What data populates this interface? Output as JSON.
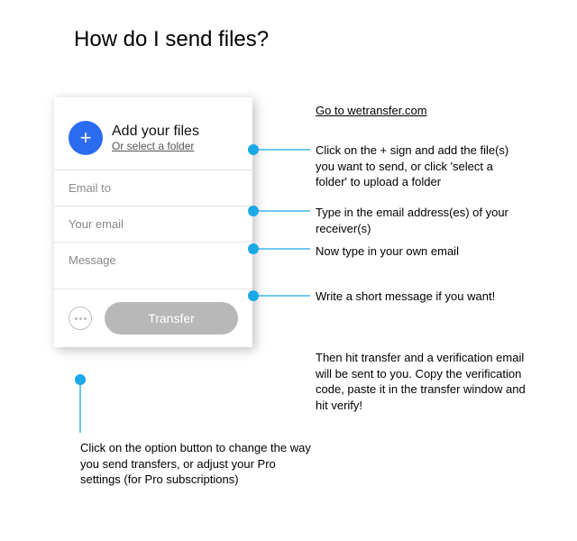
{
  "title": "How do I send files?",
  "panel": {
    "add_label": "Add your files",
    "select_folder_label": "Or select a folder",
    "email_to_placeholder": "Email to",
    "your_email_placeholder": "Your email",
    "message_placeholder": "Message",
    "transfer_label": "Transfer"
  },
  "annotations": {
    "goto": "Go to wetransfer.com",
    "add_files": "Click on the + sign and add the file(s) you want to send, or click 'select a folder' to upload a folder",
    "email_to": "Type in the email address(es) of your receiver(s)",
    "your_email": "Now type in your own email",
    "message": "Write a short message if you want!",
    "transfer": "Then hit transfer and a verification email will be sent to you. Copy the verification code, paste it in the transfer window and hit verify!",
    "options": "Click on the option button to change the way you send transfers, or adjust your Pro settings (for Pro subscriptions)"
  }
}
